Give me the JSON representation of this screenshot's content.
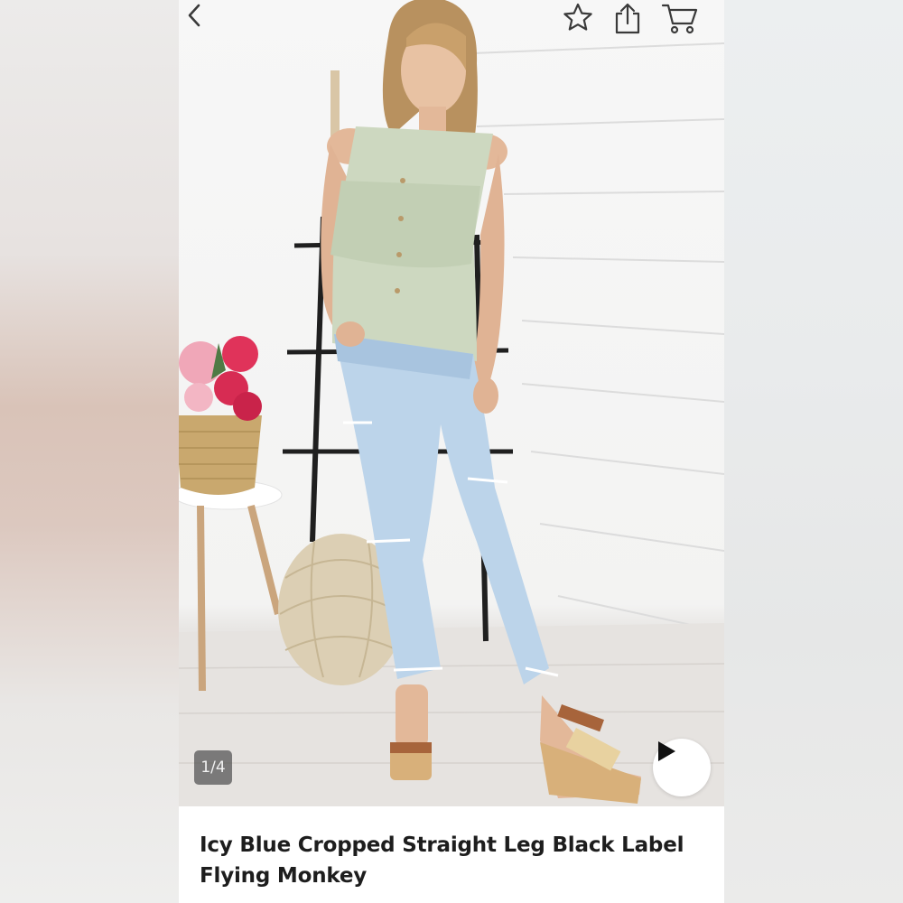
{
  "nav": {
    "back_icon": "chevron-left-icon",
    "actions": [
      {
        "name": "favorite",
        "icon": "star-icon"
      },
      {
        "name": "share",
        "icon": "share-icon"
      },
      {
        "name": "cart",
        "icon": "cart-icon"
      }
    ]
  },
  "gallery": {
    "counter": "1/4",
    "play_icon": "play-icon"
  },
  "product": {
    "title": "Icy Blue Cropped Straight Leg Black Label Flying Monkey"
  },
  "colors": {
    "icon_stroke": "#3a3a3a",
    "title_text": "#1d1d1d",
    "counter_bg": "#505050"
  }
}
